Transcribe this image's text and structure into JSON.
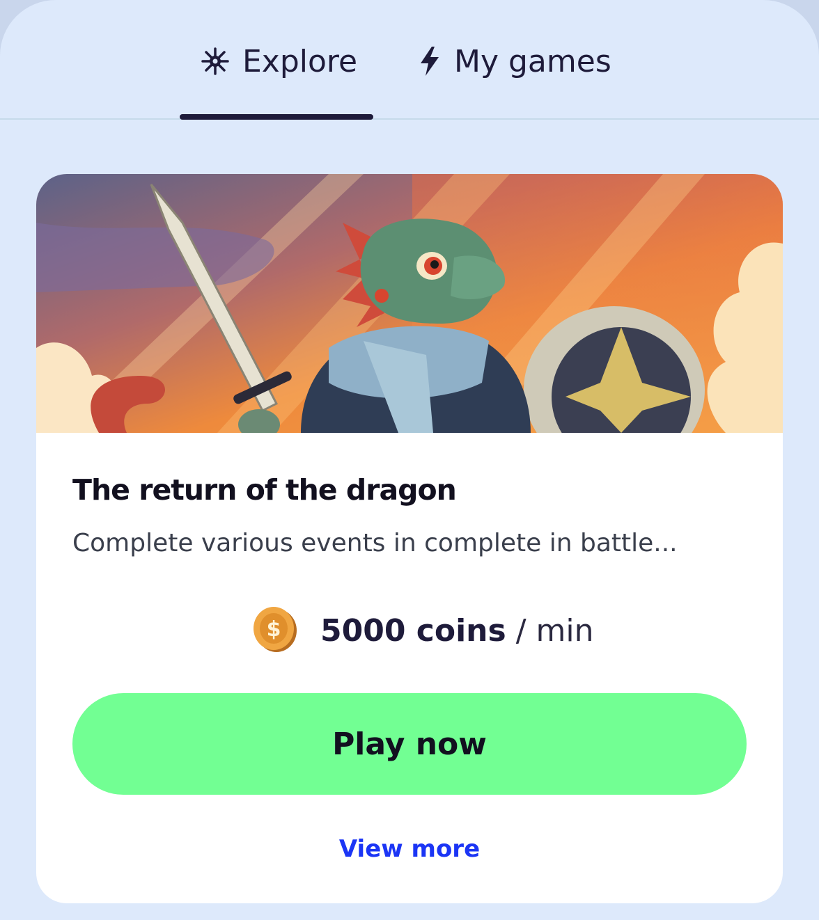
{
  "tabs": [
    {
      "label": "Explore",
      "icon": "sparkle-icon",
      "active": true
    },
    {
      "label": "My games",
      "icon": "lightning-icon",
      "active": false
    }
  ],
  "card": {
    "title": "The return of the dragon",
    "description": "Complete various events in complete in battle...",
    "reward": {
      "amount": "5000 coins",
      "separator": "/",
      "unit": "min",
      "icon": "coin-icon"
    },
    "play_label": "Play now",
    "view_more_label": "View more"
  },
  "colors": {
    "background": "#dde9fb",
    "accent_button": "#72ff93",
    "link": "#1b35f5",
    "text_dark": "#1e1b3a"
  }
}
